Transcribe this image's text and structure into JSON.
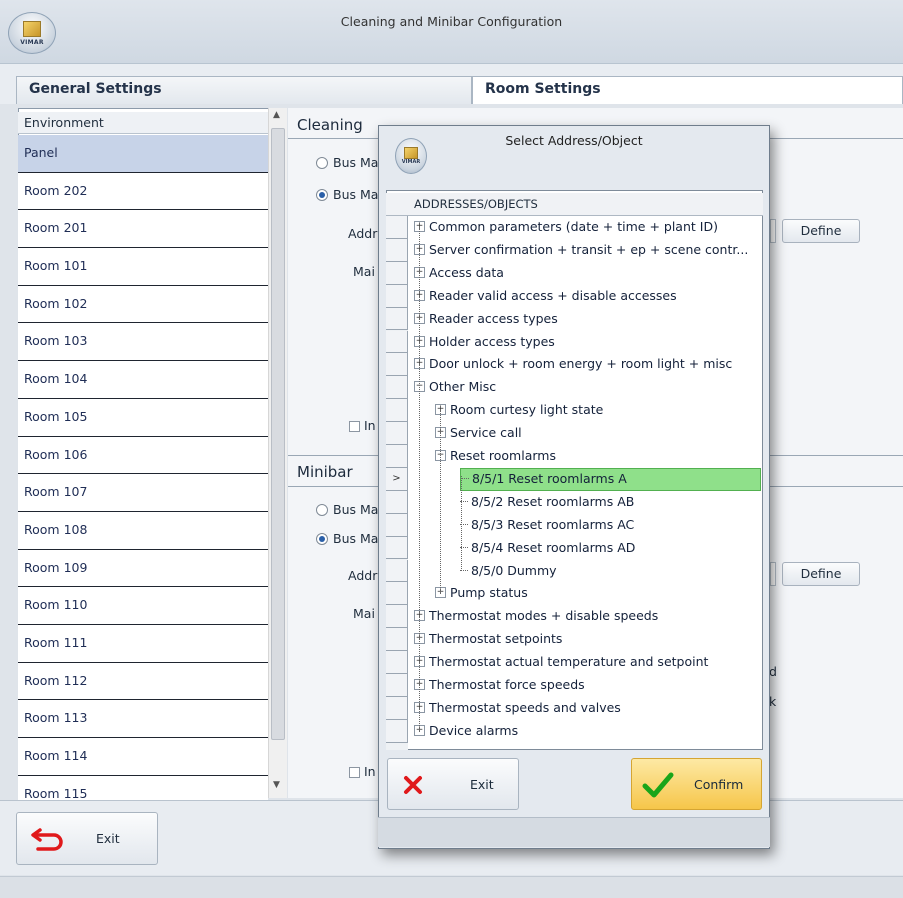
{
  "window": {
    "title": "Cleaning and Minibar Configuration",
    "logo_text": "VIMAR"
  },
  "tabs": [
    {
      "label": "General Settings"
    },
    {
      "label": "Room Settings"
    }
  ],
  "environment": {
    "header": "Environment",
    "items": [
      "Panel",
      "Room 202",
      "Room 201",
      "Room 101",
      "Room 102",
      "Room 103",
      "Room 104",
      "Room 105",
      "Room 106",
      "Room 107",
      "Room 108",
      "Room 109",
      "Room 110",
      "Room 111",
      "Room 112",
      "Room 113",
      "Room 114",
      "Room 115"
    ],
    "selected": "Panel"
  },
  "cleaning": {
    "title": "Cleaning",
    "radio1": "Bus Ma",
    "radio2": "Bus Ma",
    "addr_label": "Addr",
    "main_label": "Mai",
    "define_label": "Define",
    "check_label": "In"
  },
  "minibar": {
    "title": "Minibar",
    "radio1": "Bus Ma",
    "radio2": "Bus Ma",
    "addr_label": "Addr",
    "main_label": "Mai",
    "define_label": "Define",
    "check_label": "In",
    "partial1": "d",
    "partial2": "k"
  },
  "bottom": {
    "exit_label": "Exit"
  },
  "modal": {
    "title": "Select Address/Object",
    "logo_text": "VIMAR",
    "column_header": "ADDRESSES/OBJECTS",
    "row_pointer": ">",
    "tree": [
      {
        "label": "Common parameters (date + time + plant ID)",
        "level": 0,
        "expander": "+"
      },
      {
        "label": "Server confirmation + transit + ep + scene contr...",
        "level": 0,
        "expander": "+"
      },
      {
        "label": "Access data",
        "level": 0,
        "expander": "+"
      },
      {
        "label": "Reader valid access + disable accesses",
        "level": 0,
        "expander": "+"
      },
      {
        "label": "Reader access types",
        "level": 0,
        "expander": "+"
      },
      {
        "label": "Holder access types",
        "level": 0,
        "expander": "+"
      },
      {
        "label": "Door unlock + room energy + room light + misc",
        "level": 0,
        "expander": "+"
      },
      {
        "label": "Other Misc",
        "level": 0,
        "expander": "−"
      },
      {
        "label": "Room curtesy light state",
        "level": 1,
        "expander": "+"
      },
      {
        "label": "Service call",
        "level": 1,
        "expander": "+"
      },
      {
        "label": "Reset roomlarms",
        "level": 1,
        "expander": "−"
      },
      {
        "label": "8/5/1 Reset roomlarms A",
        "level": 2,
        "expander": "",
        "selected": true
      },
      {
        "label": "8/5/2 Reset roomlarms AB",
        "level": 2,
        "expander": ""
      },
      {
        "label": "8/5/3 Reset roomlarms AC",
        "level": 2,
        "expander": ""
      },
      {
        "label": "8/5/4 Reset roomlarms AD",
        "level": 2,
        "expander": ""
      },
      {
        "label": "8/5/0 Dummy",
        "level": 2,
        "expander": ""
      },
      {
        "label": "Pump status",
        "level": 1,
        "expander": "+"
      },
      {
        "label": "Thermostat modes + disable speeds",
        "level": 0,
        "expander": "+"
      },
      {
        "label": "Thermostat setpoints",
        "level": 0,
        "expander": "+"
      },
      {
        "label": "Thermostat actual temperature and setpoint",
        "level": 0,
        "expander": "+"
      },
      {
        "label": "Thermostat force speeds",
        "level": 0,
        "expander": "+"
      },
      {
        "label": "Thermostat speeds and valves",
        "level": 0,
        "expander": "+"
      },
      {
        "label": "Device alarms",
        "level": 0,
        "expander": "+"
      }
    ],
    "exit_label": "Exit",
    "confirm_label": "Confirm"
  }
}
